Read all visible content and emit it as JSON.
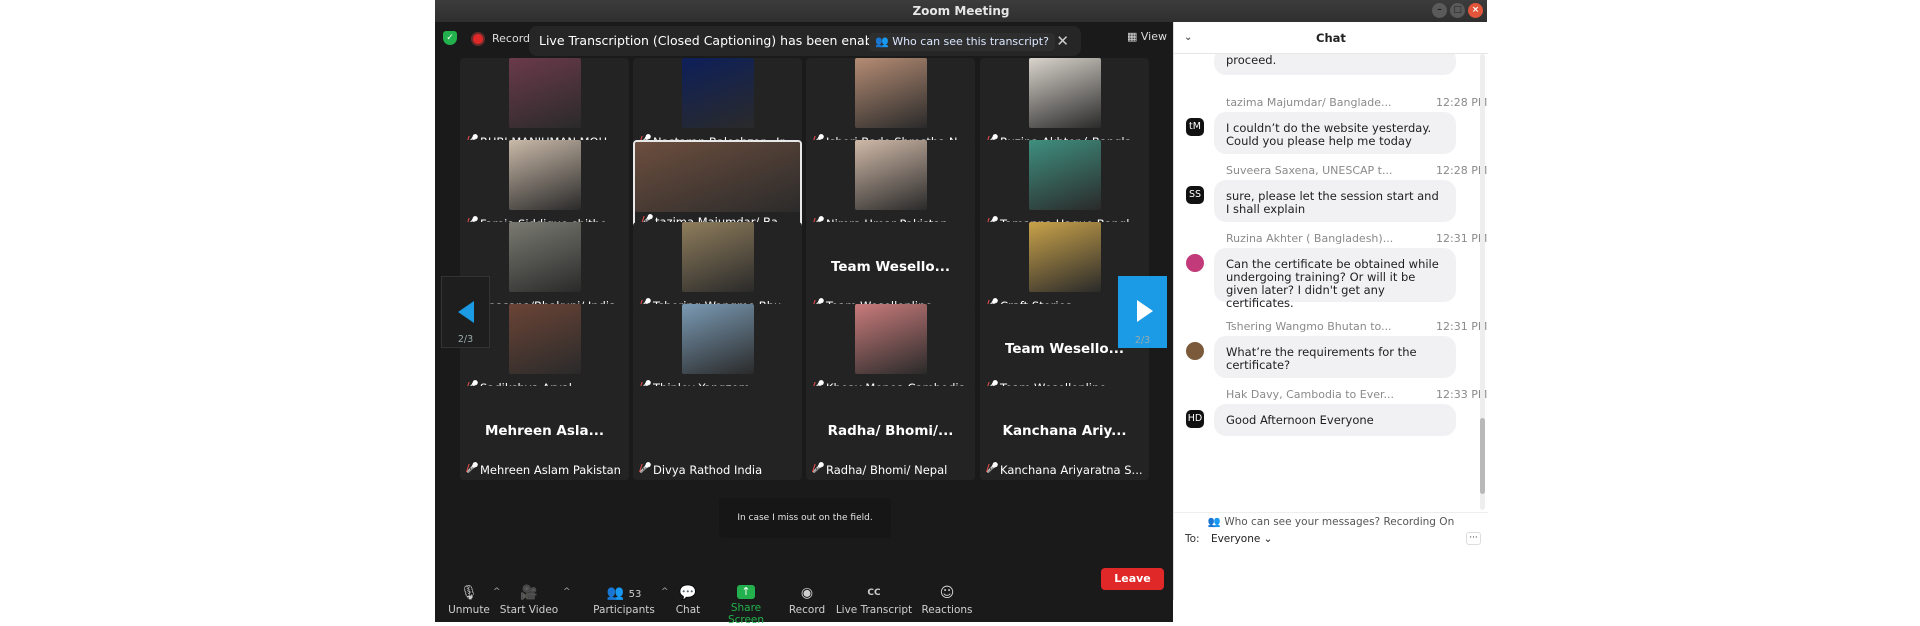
{
  "window": {
    "title": "Zoom Meeting"
  },
  "topbar": {
    "recording_label": "Recording",
    "notification": "Live Transcription (Closed Captioning) has been enabled",
    "notification_link": "Who can see this transcript?",
    "view_label": "View"
  },
  "tiles": [
    {
      "name": "RUBI MANJUMAN MOU ...",
      "photo_color": "#6b3a4a"
    },
    {
      "name": "Nastaran Baleshzar , Ir...",
      "photo_color": "#0d1f5a"
    },
    {
      "name": "Ishori Bade Shrestha N...",
      "photo_color": "#b58c74"
    },
    {
      "name": "Ruzina Akhter ( Bangla...",
      "photo_color": "#d9d4cc"
    },
    {
      "name": "Fareia Siddique shithe ...",
      "photo_color": "#c9b9a8"
    },
    {
      "name": "tazima Majumdar/ Ban...",
      "photo_color": "#6c4e3e"
    },
    {
      "name": "Nimra Umar Pakistan",
      "photo_color": "#d0b9a8"
    },
    {
      "name": "Tamanna Haque Bangl...",
      "photo_color": "#3f8f7f"
    },
    {
      "name": "Upasana/Bhakuni/ India",
      "photo_color": "#7a7a72"
    },
    {
      "name": "Tshering Wangmo Bhu...",
      "photo_color": "#8f7d5c"
    },
    {
      "name": "Team Wesellonline",
      "big": "Team Wesello..."
    },
    {
      "name": "Craft Stories",
      "photo_color": "#c9a24a"
    },
    {
      "name": "Sadikshya Aryal",
      "photo_color": "#6b4436"
    },
    {
      "name": "Thinley Yangzom",
      "photo_color": "#7a9ab4"
    },
    {
      "name": "Kheav Menea Cambodia",
      "photo_color": "#c97b7b"
    },
    {
      "name": "Team Wesellonline",
      "big": "Team Wesello..."
    },
    {
      "name": "Mehreen Aslam Pakistan",
      "big": "Mehreen Asla..."
    },
    {
      "name": "Divya Rathod India",
      "big": ""
    },
    {
      "name": "Radha/ Bhomi/ Nepal",
      "big": "Radha/ Bhomi/..."
    },
    {
      "name": "Kanchana Ariyaratna S...",
      "big": "Kanchana Ariy..."
    }
  ],
  "pagination": {
    "left": "2/3",
    "right": "2/3"
  },
  "caption_text": "In case I miss out on the field.",
  "toolbar": {
    "unmute": "Unmute",
    "start_video": "Start Video",
    "participants": "Participants",
    "participant_count": "53",
    "chat": "Chat",
    "share_screen": "Share Screen",
    "record": "Record",
    "live_transcript": "Live Transcript",
    "reactions": "Reactions",
    "leave": "Leave"
  },
  "chat": {
    "title": "Chat",
    "partial_text": "proceed.",
    "messages": [
      {
        "sender": "tazima Majumdar/ Banglade...",
        "time": "12:28 PM",
        "initials": "tM",
        "text": "I couldn’t do the website yesterday. Could you please help me today"
      },
      {
        "sender": "Suveera Saxena, UNESCAP t...",
        "time": "12:28 PM",
        "initials": "SS",
        "text": "sure, please let the session start and I shall explain"
      },
      {
        "sender": "Ruzina Akhter ( Bangladesh)...",
        "time": "12:31 PM",
        "initials": "",
        "text": "Can the certificate be obtained while undergoing training? Or will it be given later? I didn't get any certificates."
      },
      {
        "sender": "Tshering Wangmo Bhutan to...",
        "time": "12:31 PM",
        "initials": "",
        "text": "What’re the requirements for the certificate?"
      },
      {
        "sender": "Hak Davy, Cambodia to Ever...",
        "time": "12:33 PM",
        "initials": "HD",
        "text": "Good Afternoon Everyone"
      }
    ],
    "privacy_text": "Who can see your messages? Recording On",
    "to_label": "To:",
    "to_value": "Everyone"
  },
  "colors": {
    "accent_blue": "#1b9ae6",
    "leave_red": "#e02828",
    "share_green": "#22b14c"
  }
}
